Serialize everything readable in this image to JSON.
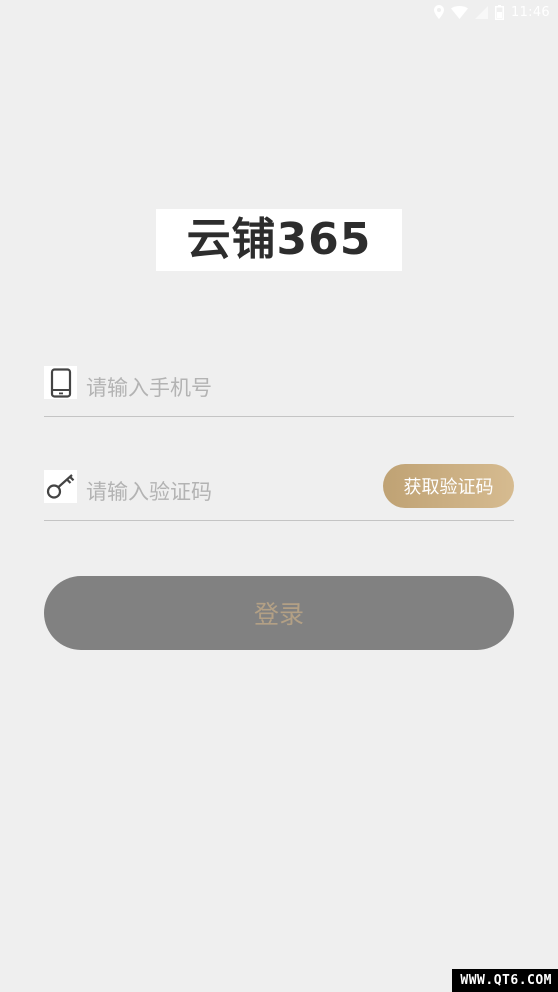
{
  "status_bar": {
    "time": "11:46",
    "icons": [
      "location-icon",
      "wifi-icon",
      "signal-icon",
      "battery-icon"
    ],
    "text_color": "#ffffff"
  },
  "logo": {
    "text": "云铺365"
  },
  "phone_field": {
    "icon": "phone-icon",
    "value": "",
    "placeholder": "请输入手机号"
  },
  "code_field": {
    "icon": "key-icon",
    "value": "",
    "placeholder": "请输入验证码",
    "get_code_label": "获取验证码"
  },
  "login": {
    "label": "登录"
  },
  "watermark": {
    "text": "WWW.QT6.COM"
  },
  "colors": {
    "background": "#efefef",
    "accent_gold": "#c9ad80",
    "login_button": "#818181",
    "login_text": "#b3a085",
    "divider": "#c4c4c4"
  }
}
